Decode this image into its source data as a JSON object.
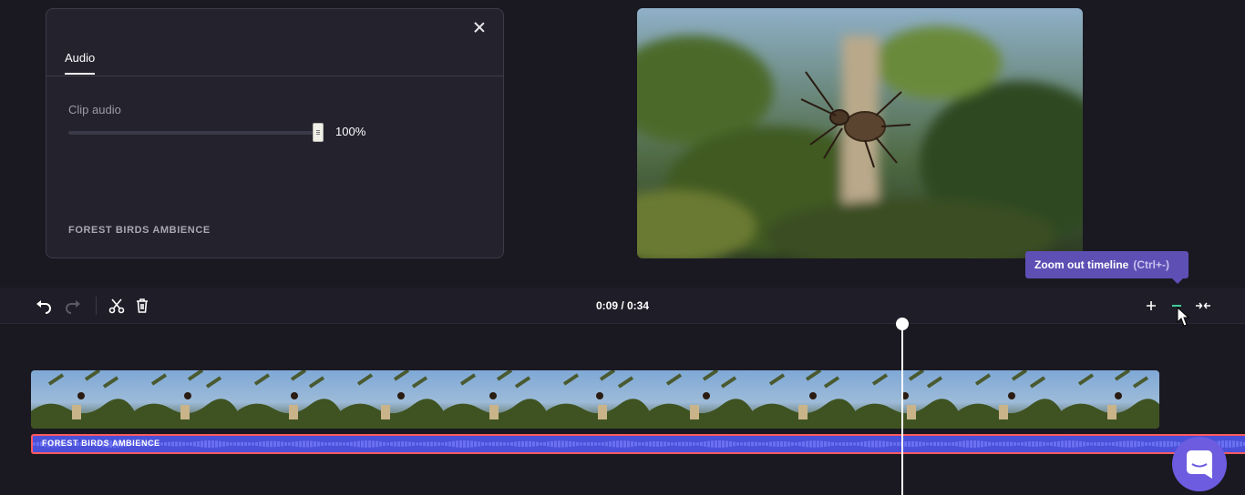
{
  "panel": {
    "tab_audio": "Audio",
    "clip_audio_label": "Clip audio",
    "volume_value": "100%",
    "volume_level": 1.0,
    "track_name": "FOREST BIRDS AMBIENCE"
  },
  "toolbar": {
    "time_display": "0:09 / 0:34"
  },
  "tooltip": {
    "text": "Zoom out timeline",
    "shortcut": "(Ctrl+-)"
  },
  "timeline": {
    "audio_label": "FOREST BIRDS AMBIENCE",
    "thumb_count": 11
  },
  "colors": {
    "accent": "#5e4fb5",
    "audio_track": "#4a50d8",
    "audio_border": "#ff5a5f",
    "zoom_out_icon": "#3fcf9a"
  },
  "icons": [
    "close-icon",
    "undo-icon",
    "redo-icon",
    "scissors-icon",
    "trash-icon",
    "zoom-in-icon",
    "zoom-out-icon",
    "fit-icon",
    "chat-icon"
  ]
}
